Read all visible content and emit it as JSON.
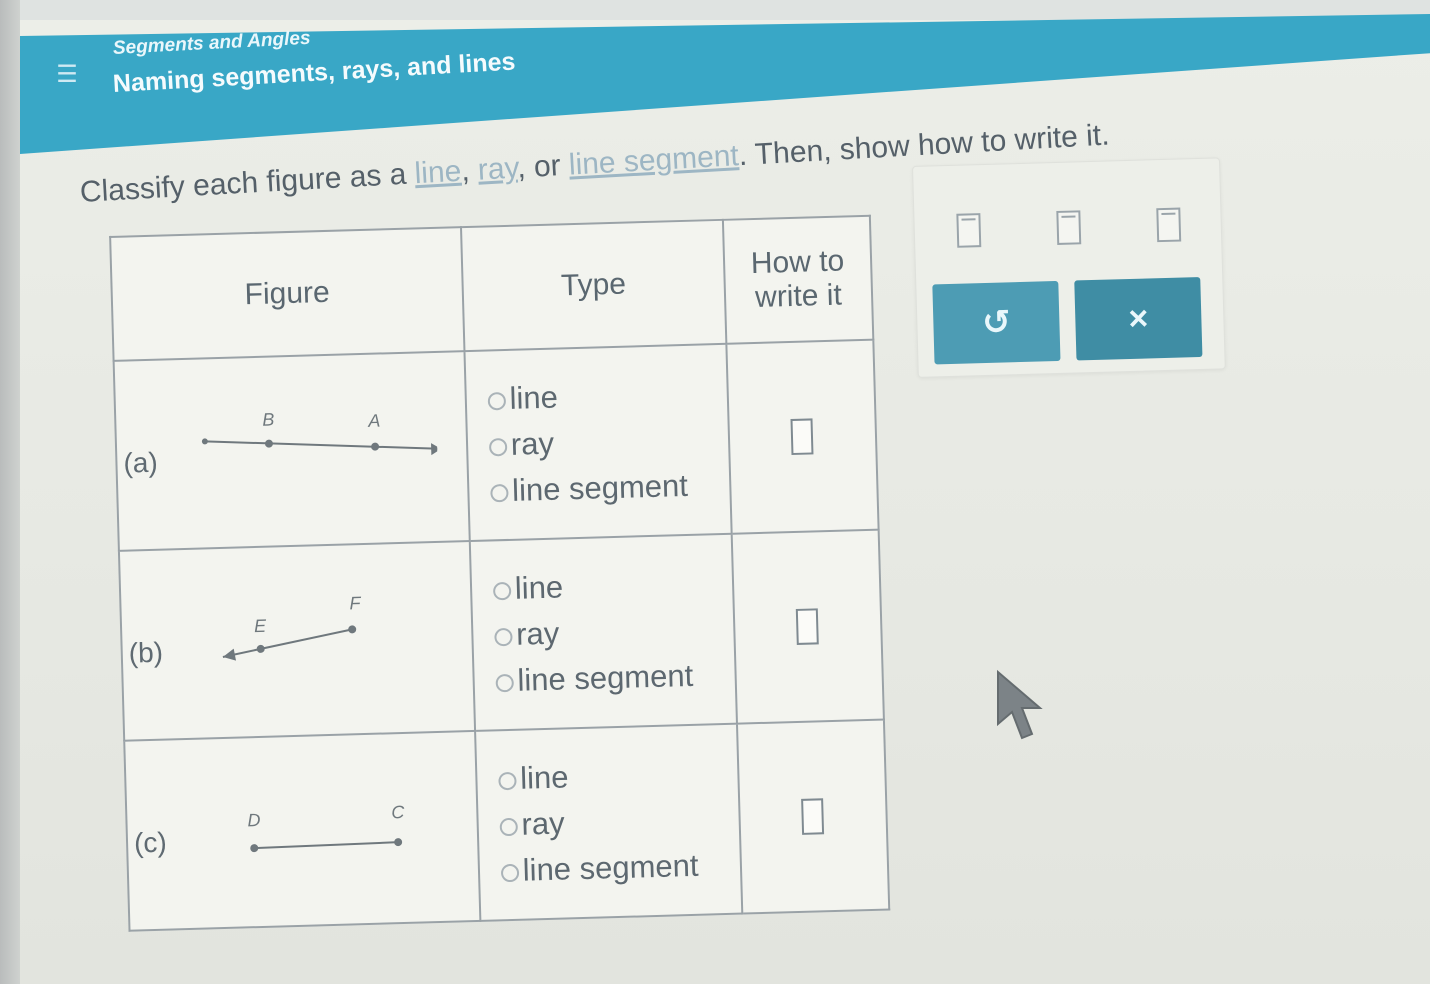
{
  "header": {
    "topic": "Segments and Angles",
    "subtopic": "Naming segments, rays, and lines"
  },
  "instructions": {
    "prefix": "Classify each figure as a ",
    "link_line": "line",
    "sep1": ", ",
    "link_ray": "ray",
    "sep2": ", or ",
    "link_segment": "line segment",
    "suffix": ". Then, show how to write it."
  },
  "table": {
    "headers": {
      "figure": "Figure",
      "type": "Type",
      "write_line1": "How to",
      "write_line2": "write it"
    },
    "rows": [
      {
        "label": "(a)",
        "point1": "B",
        "point2": "A",
        "options": [
          "line",
          "ray",
          "line segment"
        ]
      },
      {
        "label": "(b)",
        "point1": "E",
        "point2": "F",
        "options": [
          "line",
          "ray",
          "line segment"
        ]
      },
      {
        "label": "(c)",
        "point1": "D",
        "point2": "C",
        "options": [
          "line",
          "ray",
          "line segment"
        ]
      }
    ]
  },
  "toolbar": {
    "undo_symbol": "↺",
    "clear_symbol": "×",
    "icons": [
      "segment-notation-icon",
      "ray-notation-icon",
      "line-notation-icon"
    ]
  },
  "colors": {
    "header_bg": "#39a7c6",
    "button_bg": "#4d9cb4",
    "link": "#9db6c4"
  }
}
